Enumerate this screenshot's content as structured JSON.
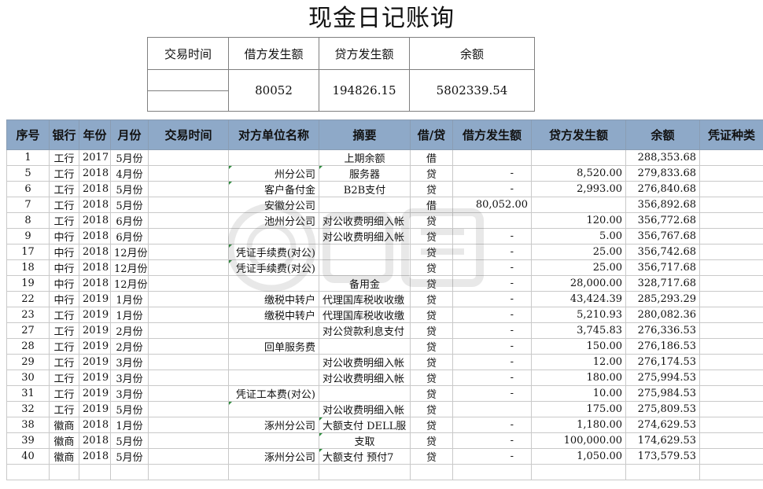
{
  "title": "现金日记账询",
  "summary": {
    "headers": [
      "交易时间",
      "借方发生额",
      "贷方发生额",
      "余额"
    ],
    "values": [
      "80052",
      "194826.15",
      "5802339.54"
    ]
  },
  "table": {
    "headers": [
      "序号",
      "银行",
      "年份",
      "月份",
      "交易时间",
      "对方单位名称",
      "摘要",
      "借/贷",
      "借方发生额",
      "贷方发生额",
      "余额",
      "凭证种类"
    ],
    "rows": [
      [
        "1",
        "工行",
        "2017",
        "5月份",
        "",
        "",
        "上期余额",
        "借",
        "",
        "",
        "288,353.68",
        ""
      ],
      [
        "5",
        "工行",
        "2018",
        "4月份",
        "",
        "州分公司",
        "服务器",
        "贷",
        "-",
        "8,520.00",
        "279,833.68",
        ""
      ],
      [
        "6",
        "工行",
        "2018",
        "5月份",
        "",
        "客户备付金",
        "B2B支付",
        "贷",
        "-",
        "2,993.00",
        "276,840.68",
        ""
      ],
      [
        "7",
        "工行",
        "2018",
        "5月份",
        "",
        "安徽分公司",
        "",
        "借",
        "80,052.00",
        "",
        "356,892.68",
        ""
      ],
      [
        "8",
        "工行",
        "2018",
        "6月份",
        "",
        "池州分公司",
        "对公收费明细入帐",
        "贷",
        "",
        "120.00",
        "356,772.68",
        ""
      ],
      [
        "9",
        "中行",
        "2018",
        "6月份",
        "",
        "",
        "对公收费明细入帐",
        "贷",
        "-",
        "5.00",
        "356,767.68",
        ""
      ],
      [
        "17",
        "中行",
        "2018",
        "12月份",
        "",
        "凭证手续费(对公)",
        "",
        "贷",
        "-",
        "25.00",
        "356,742.68",
        ""
      ],
      [
        "18",
        "中行",
        "2018",
        "12月份",
        "",
        "凭证手续费(对公)",
        "",
        "贷",
        "-",
        "25.00",
        "356,717.68",
        ""
      ],
      [
        "19",
        "中行",
        "2018",
        "12月份",
        "",
        "",
        "备用金",
        "贷",
        "-",
        "28,000.00",
        "328,717.68",
        ""
      ],
      [
        "22",
        "中行",
        "2019",
        "1月份",
        "",
        "缴税中转户",
        "代理国库税收收缴",
        "贷",
        "-",
        "43,424.39",
        "285,293.29",
        ""
      ],
      [
        "23",
        "工行",
        "2019",
        "1月份",
        "",
        "缴税中转户",
        "代理国库税收收缴",
        "贷",
        "-",
        "5,210.93",
        "280,082.36",
        ""
      ],
      [
        "27",
        "工行",
        "2019",
        "2月份",
        "",
        "",
        "对公贷款利息支付",
        "贷",
        "-",
        "3,745.83",
        "276,336.53",
        ""
      ],
      [
        "28",
        "工行",
        "2019",
        "2月份",
        "",
        "回单服务费",
        "",
        "贷",
        "-",
        "150.00",
        "276,186.53",
        ""
      ],
      [
        "29",
        "工行",
        "2019",
        "3月份",
        "",
        "",
        "对公收费明细入帐",
        "贷",
        "-",
        "12.00",
        "276,174.53",
        ""
      ],
      [
        "30",
        "工行",
        "2019",
        "3月份",
        "",
        "",
        "对公收费明细入帐",
        "贷",
        "-",
        "180.00",
        "275,994.53",
        ""
      ],
      [
        "31",
        "工行",
        "2019",
        "3月份",
        "",
        "凭证工本费(对公)",
        "",
        "贷",
        "-",
        "10.00",
        "275,984.53",
        ""
      ],
      [
        "32",
        "工行",
        "2019",
        "5月份",
        "",
        "",
        "对公收费明细入帐",
        "贷",
        "",
        "175.00",
        "275,809.53",
        ""
      ],
      [
        "38",
        "徽商",
        "2018",
        "1月份",
        "",
        "涿州分公司",
        "大额支付 DELL服",
        "贷",
        "-",
        "1,180.00",
        "274,629.53",
        ""
      ],
      [
        "39",
        "徽商",
        "2018",
        "5月份",
        "",
        "",
        "支取",
        "贷",
        "-",
        "100,000.00",
        "174,629.53",
        ""
      ],
      [
        "40",
        "徽商",
        "2018",
        "5月份",
        "",
        "涿州分公司",
        "大额支付 预付7",
        "贷",
        "-",
        "1,050.00",
        "173,579.53",
        ""
      ],
      [
        "",
        "",
        "",
        "",
        "",
        "",
        "",
        "",
        "",
        "",
        "",
        ""
      ]
    ]
  },
  "colors": {
    "header_bg": "#8ea9c8",
    "marker": "#2e8b3d"
  },
  "watermark": {
    "icon": "brand-watermark-icon"
  }
}
